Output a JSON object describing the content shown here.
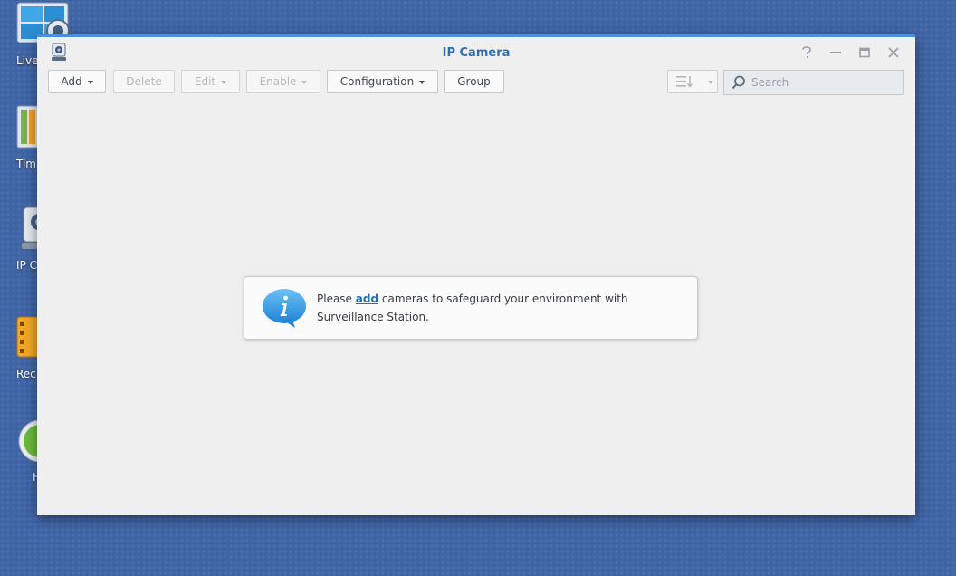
{
  "desktop": {
    "icons": [
      {
        "label": "Live",
        "icon": "live-view-icon"
      },
      {
        "label": "Tim",
        "icon": "timeline-icon"
      },
      {
        "label": "IP C",
        "icon": "ip-camera-icon"
      },
      {
        "label": "Rec",
        "icon": "recording-icon"
      },
      {
        "label": "H",
        "icon": "help-icon"
      }
    ]
  },
  "window": {
    "title": "IP Camera",
    "app_icon": "ip-camera-icon",
    "controls": {
      "help": "?",
      "minimize": "—",
      "maximize": "▭",
      "close": "✕"
    }
  },
  "toolbar": {
    "add_label": "Add",
    "delete_label": "Delete",
    "edit_label": "Edit",
    "enable_label": "Enable",
    "configuration_label": "Configuration",
    "group_label": "Group",
    "view_icon": "sort-list-icon",
    "search_placeholder": "Search"
  },
  "message": {
    "text_before": "Please ",
    "link": "add",
    "text_after": " cameras to safeguard your environment with Surveillance Station."
  },
  "colors": {
    "desktop_bg": "#4166a8",
    "accent": "#4a90d9",
    "title": "#2d6fb3",
    "link": "#1f6fbf"
  }
}
